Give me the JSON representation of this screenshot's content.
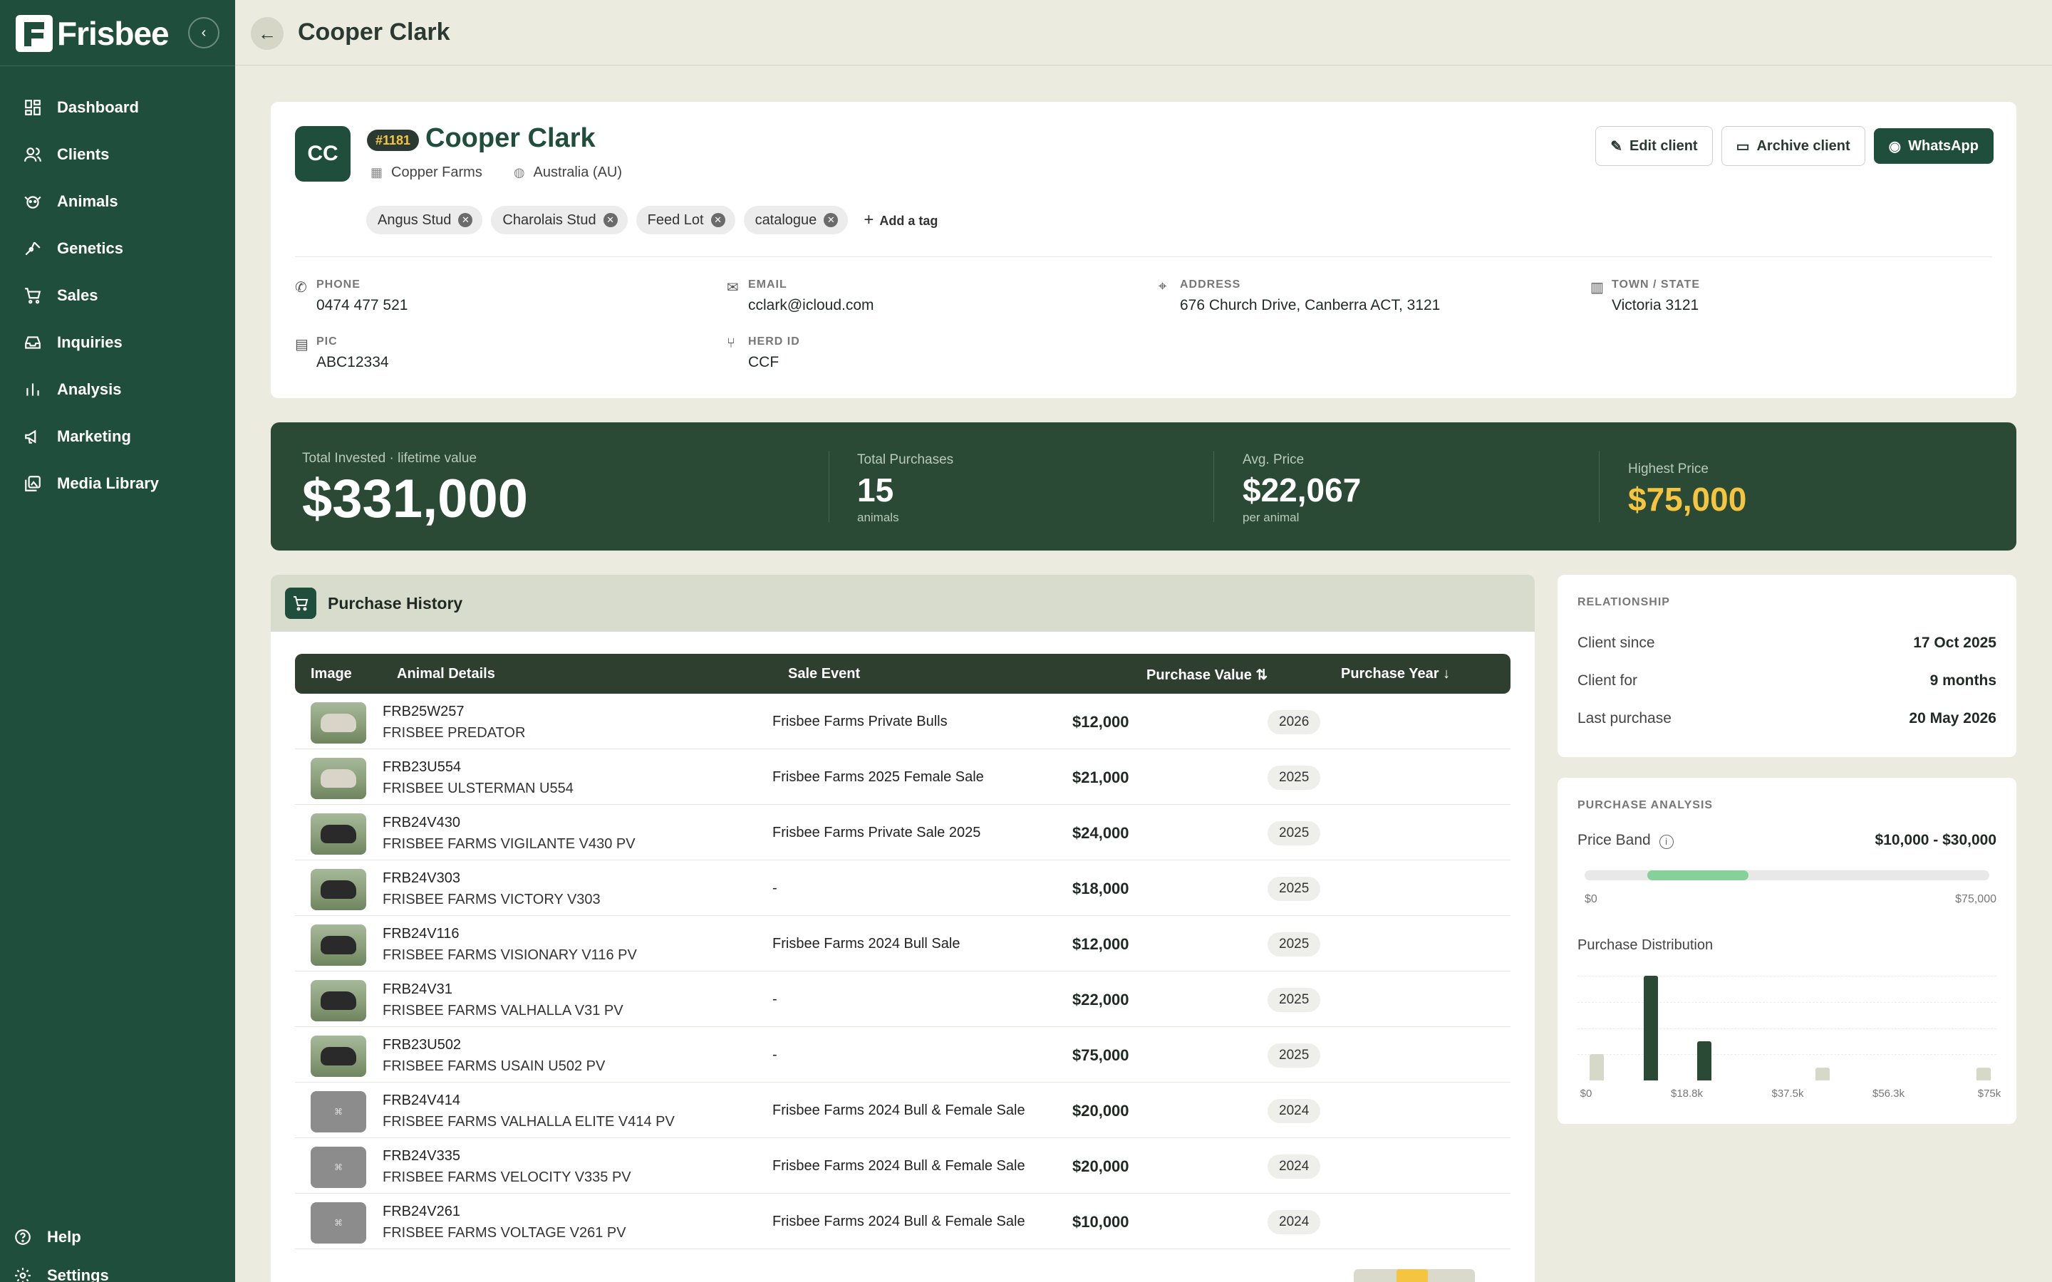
{
  "app": {
    "brand": "Frisbee"
  },
  "sidebar": {
    "items": [
      {
        "label": "Dashboard",
        "icon": "dashboard-icon"
      },
      {
        "label": "Clients",
        "icon": "users-icon"
      },
      {
        "label": "Animals",
        "icon": "animal-icon"
      },
      {
        "label": "Genetics",
        "icon": "genetics-icon"
      },
      {
        "label": "Sales",
        "icon": "cart-icon"
      },
      {
        "label": "Inquiries",
        "icon": "inbox-icon"
      },
      {
        "label": "Analysis",
        "icon": "bar-chart-icon"
      },
      {
        "label": "Marketing",
        "icon": "megaphone-icon"
      },
      {
        "label": "Media Library",
        "icon": "image-gallery-icon"
      }
    ],
    "bottom": [
      {
        "label": "Help",
        "icon": "help-icon"
      },
      {
        "label": "Settings",
        "icon": "gear-icon"
      }
    ]
  },
  "header": {
    "title": "Cooper Clark"
  },
  "client": {
    "initials": "CC",
    "id_badge": "#1181",
    "name": "Cooper Clark",
    "company": "Copper Farms",
    "country": "Australia (AU)",
    "tags": [
      "Angus Stud",
      "Charolais Stud",
      "Feed Lot",
      "catalogue"
    ],
    "add_tag_label": "Add a tag",
    "actions": {
      "edit": "Edit client",
      "archive": "Archive client",
      "whatsapp": "WhatsApp"
    },
    "fields": {
      "phone": {
        "label": "PHONE",
        "value": "0474 477 521"
      },
      "email": {
        "label": "EMAIL",
        "value": "cclark@icloud.com"
      },
      "address": {
        "label": "ADDRESS",
        "value": "676 Church Drive, Canberra ACT, 3121"
      },
      "town": {
        "label": "TOWN / STATE",
        "value": "Victoria 3121"
      },
      "pic": {
        "label": "PIC",
        "value": "ABC12334"
      },
      "herd": {
        "label": "HERD ID",
        "value": "CCF"
      }
    }
  },
  "stats": {
    "total_invested": {
      "label": "Total Invested · lifetime value",
      "value": "$331,000"
    },
    "total_purchases": {
      "label": "Total Purchases",
      "value": "15",
      "sub": "animals"
    },
    "avg_price": {
      "label": "Avg. Price",
      "value": "$22,067",
      "sub": "per animal"
    },
    "highest_price": {
      "label": "Highest Price",
      "value": "$75,000"
    }
  },
  "history": {
    "title": "Purchase History",
    "columns": {
      "image": "Image",
      "details": "Animal Details",
      "event": "Sale Event",
      "value": "Purchase Value ⇅",
      "year": "Purchase Year ↓"
    },
    "rows": [
      {
        "id": "FRB25W257",
        "name": "FRISBEE PREDATOR",
        "event": "Frisbee Farms Private Bulls",
        "value": "$12,000",
        "year": "2026",
        "image": "photo-light"
      },
      {
        "id": "FRB23U554",
        "name": "FRISBEE ULSTERMAN U554",
        "event": "Frisbee Farms 2025 Female Sale",
        "value": "$21,000",
        "year": "2025",
        "image": "photo-light"
      },
      {
        "id": "FRB24V430",
        "name": "FRISBEE FARMS VIGILANTE V430 PV",
        "event": "Frisbee Farms Private Sale 2025",
        "value": "$24,000",
        "year": "2025",
        "image": "photo-dark"
      },
      {
        "id": "FRB24V303",
        "name": "FRISBEE FARMS VICTORY V303",
        "event": "-",
        "value": "$18,000",
        "year": "2025",
        "image": "photo-dark"
      },
      {
        "id": "FRB24V116",
        "name": "FRISBEE FARMS VISIONARY V116 PV",
        "event": "Frisbee Farms 2024 Bull Sale",
        "value": "$12,000",
        "year": "2025",
        "image": "photo-dark"
      },
      {
        "id": "FRB24V31",
        "name": "FRISBEE FARMS VALHALLA V31 PV",
        "event": "-",
        "value": "$22,000",
        "year": "2025",
        "image": "photo-dark"
      },
      {
        "id": "FRB23U502",
        "name": "FRISBEE FARMS USAIN U502 PV",
        "event": "-",
        "value": "$75,000",
        "year": "2025",
        "image": "photo-dark"
      },
      {
        "id": "FRB24V414",
        "name": "FRISBEE FARMS VALHALLA ELITE V414 PV",
        "event": "Frisbee Farms 2024 Bull & Female Sale",
        "value": "$20,000",
        "year": "2024",
        "image": "placeholder"
      },
      {
        "id": "FRB24V335",
        "name": "FRISBEE FARMS VELOCITY V335 PV",
        "event": "Frisbee Farms 2024 Bull & Female Sale",
        "value": "$20,000",
        "year": "2024",
        "image": "placeholder"
      },
      {
        "id": "FRB24V261",
        "name": "FRISBEE FARMS VOLTAGE V261 PV",
        "event": "Frisbee Farms 2024 Bull & Female Sale",
        "value": "$10,000",
        "year": "2024",
        "image": "placeholder"
      }
    ]
  },
  "relationship": {
    "label": "RELATIONSHIP",
    "items": [
      {
        "k": "Client since",
        "v": "17 Oct 2025"
      },
      {
        "k": "Client for",
        "v": "9 months"
      },
      {
        "k": "Last purchase",
        "v": "20 May 2026"
      }
    ]
  },
  "analysis": {
    "label": "PURCHASE ANALYSIS",
    "price_band_label": "Price Band",
    "price_band_value": "$10,000 - $30,000",
    "band_min_label": "$0",
    "band_max_label": "$75,000",
    "distribution_title": "Purchase Distribution"
  },
  "chart_data": {
    "type": "bar",
    "title": "Purchase Distribution",
    "x_ticks": [
      "$0",
      "$18.8k",
      "$37.5k",
      "$56.3k",
      "$75k"
    ],
    "x_range": [
      0,
      75000
    ],
    "bins": [
      {
        "x": 2000,
        "count": 2,
        "in_band": false
      },
      {
        "x": 12000,
        "count": 8,
        "in_band": true
      },
      {
        "x": 22000,
        "count": 3,
        "in_band": true
      },
      {
        "x": 44000,
        "count": 1,
        "in_band": false
      },
      {
        "x": 74000,
        "count": 1,
        "in_band": false
      }
    ],
    "colors": {
      "in_band": "#2b4a35",
      "out_band": "#d6d8c8"
    },
    "ylim": [
      0,
      8
    ]
  }
}
